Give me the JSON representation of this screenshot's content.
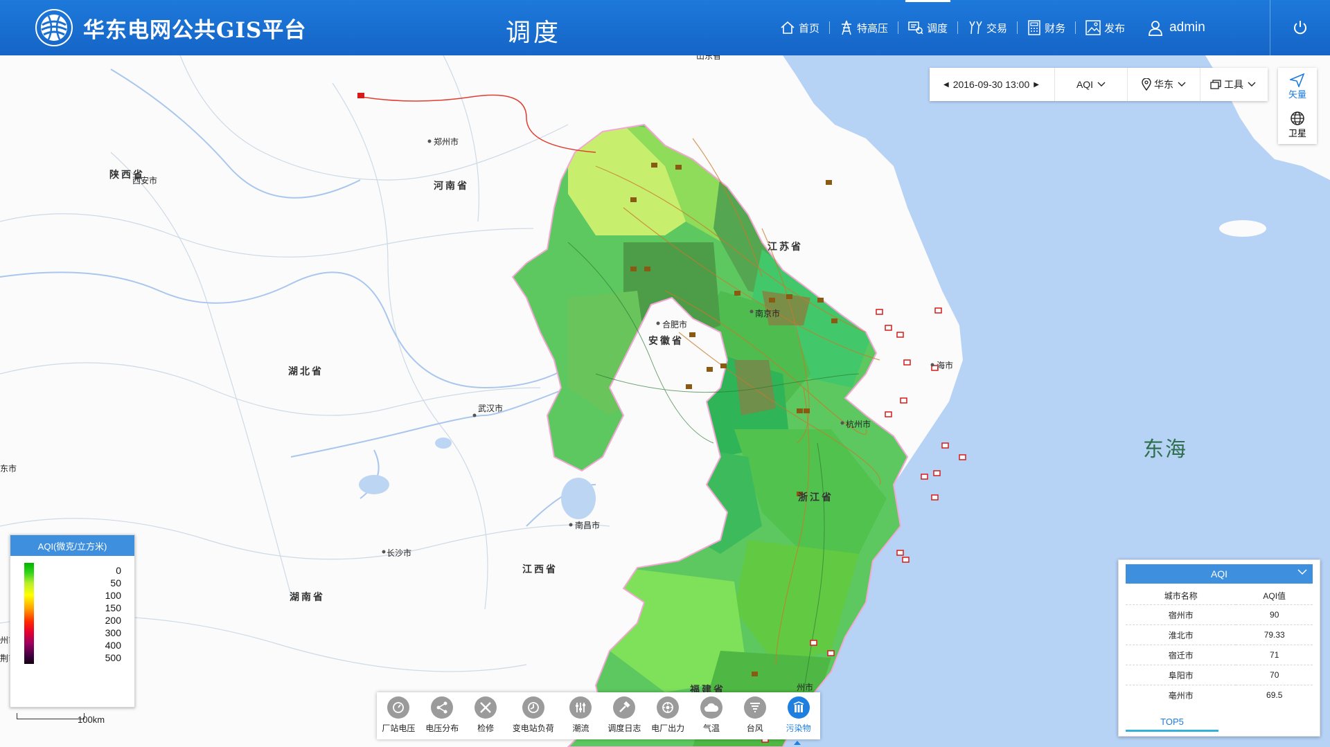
{
  "header": {
    "brand": "华东电网公共GIS平台",
    "page_title": "调度",
    "nav": [
      {
        "label": "首页",
        "icon": "home-icon"
      },
      {
        "label": "特高压",
        "icon": "tower-icon"
      },
      {
        "label": "调度",
        "icon": "dispatch-icon",
        "active": true
      },
      {
        "label": "交易",
        "icon": "trade-icon"
      },
      {
        "label": "财务",
        "icon": "calculator-icon"
      },
      {
        "label": "发布",
        "icon": "publish-icon"
      }
    ],
    "user": "admin",
    "colors": {
      "bar": "#1a6fd3",
      "accent": "#3f8fdf"
    }
  },
  "toolbar": {
    "datetime": "2016-09-30 13:00",
    "layer": "AQI",
    "region": "华东",
    "tools": "工具"
  },
  "map_type": {
    "vector": "矢量",
    "satellite": "卫星"
  },
  "map": {
    "cities": {
      "zhengzhou": "郑州市",
      "xian": "西安市",
      "wuhan": "武汉市",
      "changsha": "长沙市",
      "nanchang": "南昌市",
      "hefei": "合肥市",
      "nanjing": "南京市",
      "hangzhou": "杭州市",
      "shanghai": "海市",
      "fuzhou": "州市",
      "top": "山东省"
    },
    "provinces": {
      "shaanxi": "陕西省",
      "henan": "河南省",
      "hubei": "湖北省",
      "hunan": "湖南省",
      "jiangxi": "江西省",
      "anhui": "安徽省",
      "jiangsu": "江苏省",
      "zhejiang": "浙江省",
      "fujian": "福建省"
    },
    "sea": "东海",
    "edge_labels": [
      "东市",
      "州市",
      "荆市"
    ]
  },
  "legend": {
    "title": "AQI(微克/立方米)",
    "values": [
      "0",
      "50",
      "100",
      "150",
      "200",
      "300",
      "400",
      "500"
    ],
    "scale": "100km"
  },
  "aqi_panel": {
    "title": "AQI",
    "columns": [
      "城市名称",
      "AQI值"
    ],
    "rows": [
      {
        "city": "宿州市",
        "value": "90"
      },
      {
        "city": "淮北市",
        "value": "79.33"
      },
      {
        "city": "宿迁市",
        "value": "71"
      },
      {
        "city": "阜阳市",
        "value": "70"
      },
      {
        "city": "亳州市",
        "value": "69.5"
      }
    ],
    "tab": "TOP5"
  },
  "bottom_toolbar": [
    {
      "label": "厂站电压",
      "icon": "gauge-icon"
    },
    {
      "label": "电压分布",
      "icon": "share-icon"
    },
    {
      "label": "检修",
      "icon": "tools-icon"
    },
    {
      "label": "变电站负荷",
      "icon": "dial-icon"
    },
    {
      "label": "潮流",
      "icon": "sliders-icon"
    },
    {
      "label": "调度日志",
      "icon": "hammer-icon"
    },
    {
      "label": "电厂出力",
      "icon": "plant-icon"
    },
    {
      "label": "气温",
      "icon": "cloud-icon"
    },
    {
      "label": "台风",
      "icon": "typhoon-icon"
    },
    {
      "label": "污染物",
      "icon": "pollutant-icon",
      "active": true
    }
  ]
}
